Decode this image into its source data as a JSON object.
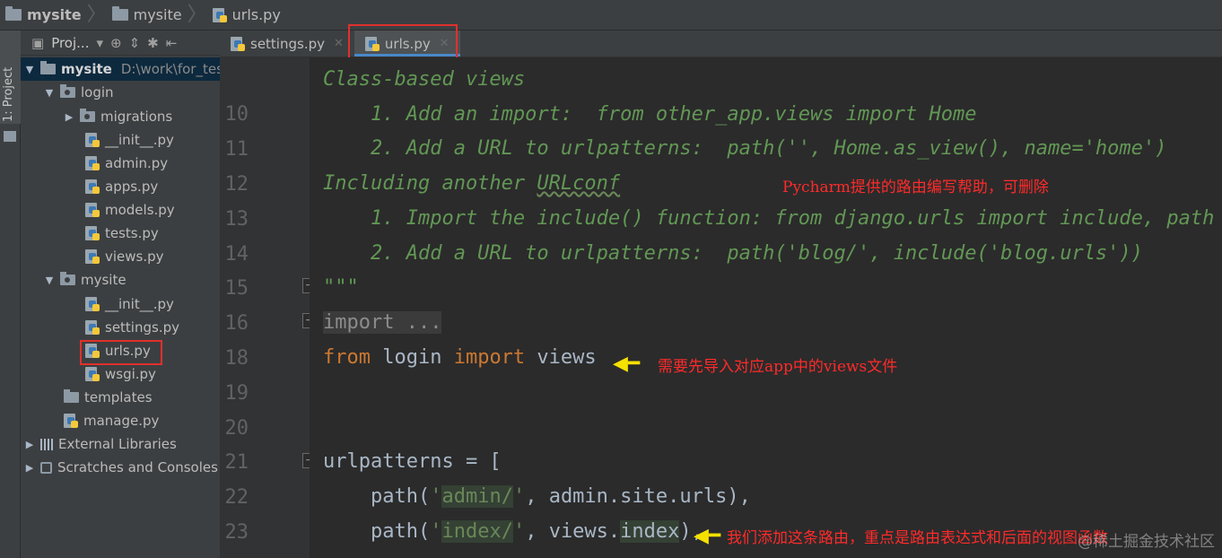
{
  "breadcrumb": [
    "mysite",
    "mysite",
    "urls.py"
  ],
  "side_strip": {
    "label": "1: Project"
  },
  "project_panel": {
    "title": "Proj...",
    "tree": [
      {
        "label": "mysite",
        "path": "D:\\work\\for_test",
        "type": "root",
        "expanded": true
      },
      {
        "label": "login",
        "type": "package",
        "expanded": true
      },
      {
        "label": "migrations",
        "type": "package",
        "expanded": false
      },
      {
        "label": "__init__.py",
        "type": "py"
      },
      {
        "label": "admin.py",
        "type": "py"
      },
      {
        "label": "apps.py",
        "type": "py"
      },
      {
        "label": "models.py",
        "type": "py"
      },
      {
        "label": "tests.py",
        "type": "py"
      },
      {
        "label": "views.py",
        "type": "py"
      },
      {
        "label": "mysite",
        "type": "package",
        "expanded": true
      },
      {
        "label": "__init__.py",
        "type": "py"
      },
      {
        "label": "settings.py",
        "type": "py"
      },
      {
        "label": "urls.py",
        "type": "py",
        "highlighted": true
      },
      {
        "label": "wsgi.py",
        "type": "py"
      },
      {
        "label": "templates",
        "type": "folder"
      },
      {
        "label": "manage.py",
        "type": "py"
      },
      {
        "label": "External Libraries",
        "type": "libs",
        "expanded": false
      },
      {
        "label": "Scratches and Consoles",
        "type": "scratch",
        "expanded": false
      }
    ]
  },
  "tabs": [
    {
      "label": "settings.py",
      "active": false
    },
    {
      "label": "urls.py",
      "active": true
    }
  ],
  "line_numbers": [
    "10",
    "11",
    "12",
    "13",
    "14",
    "15",
    "16",
    "18",
    "19",
    "20",
    "21",
    "22",
    "23"
  ],
  "code": {
    "top_partial": "Class-based views",
    "l10": "    1. Add an import:  from other_app.views import Home",
    "l11": "    2. Add a URL to urlpatterns:  path('', Home.as_view(), name='home')",
    "l12a": "Including another ",
    "l12b": "URLconf",
    "l13": "    1. Import the include() function: from django.urls import include, path",
    "l14": "    2. Add a URL to urlpatterns:  path('blog/', include('blog.urls'))",
    "l15": "\"\"\"",
    "l16": "import ...",
    "l18_from": "from",
    "l18_mod": " login ",
    "l18_import": "import",
    "l18_name": " views",
    "l21": "urlpatterns = [",
    "l22_a": "    path(",
    "l22_s1": "'",
    "l22_s2": "admin/",
    "l22_s3": "'",
    "l22_b": ", admin.site.urls),",
    "l23_a": "    path(",
    "l23_s1": "'",
    "l23_s2": "index/",
    "l23_s3": "'",
    "l23_b": ", views.",
    "l23_c": "index",
    "l23_d": "),"
  },
  "annotations": {
    "pycharm_help": "Pycharm提供的路由编写帮助，可删除",
    "import_views": "需要先导入对应app中的views文件",
    "route_added": "我们添加这条路由，重点是路由表达式和后面的视图函数"
  },
  "watermark": "@稀土掘金技术社区",
  "colors": {
    "annotation": "#ff2a2a",
    "highlight_box": "#e0302c",
    "arrow": "#f5e100"
  }
}
